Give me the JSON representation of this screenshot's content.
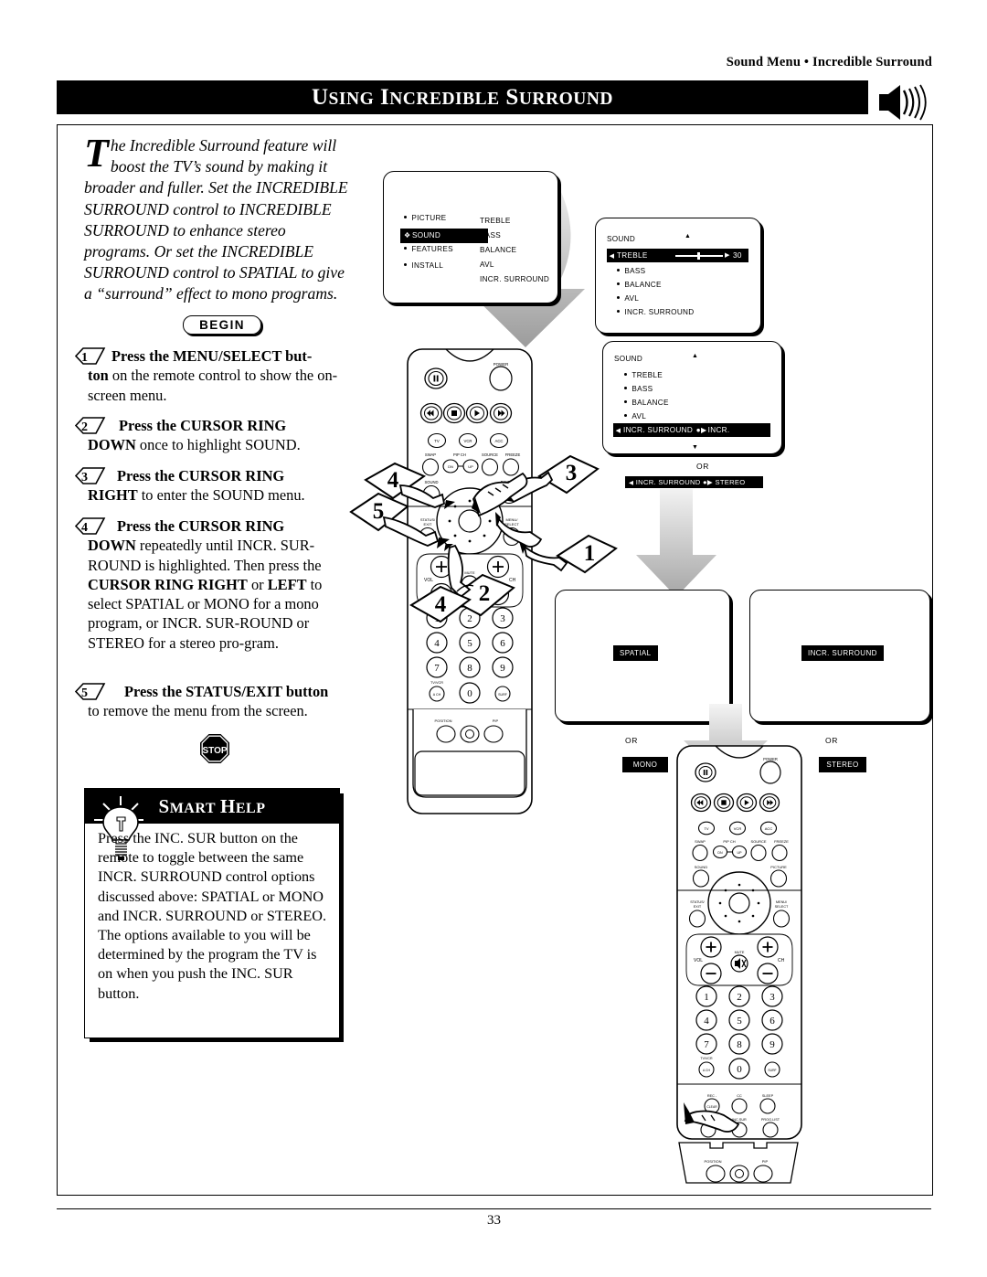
{
  "header": {
    "kicker": "Sound Menu • Incredible Surround",
    "title_word1_cap": "U",
    "title_word1_rest": "SING",
    "title_word2_cap": "I",
    "title_word2_rest": "NCREDIBLE",
    "title_word3_cap": "S",
    "title_word3_rest": "URROUND",
    "speaker_icon": "speaker-sound-icon"
  },
  "intro": {
    "dropcap": "T",
    "text": "he Incredible Surround feature will boost the TV’s sound by making it broader and fuller. Set the INCREDIBLE SURROUND control to INCREDIBLE SURROUND to enhance stereo programs. Or set the INCREDIBLE SURROUND control to SPATIAL to give a “surround” effect to mono programs."
  },
  "begin_label": "BEGIN",
  "steps": [
    {
      "n": "1",
      "lead": "Press the MENU/SELECT but-",
      "lead2": "ton",
      "rest": " on the remote control to show the on-screen menu."
    },
    {
      "n": "2",
      "lead": "Press the CURSOR RING",
      "lead2": "DOWN",
      "rest": " once to highlight SOUND."
    },
    {
      "n": "3",
      "lead": "Press the CURSOR RING",
      "lead2": "RIGHT",
      "rest": " to enter the SOUND menu."
    },
    {
      "n": "4",
      "lead": "Press the CURSOR RING",
      "lead2": "DOWN",
      "rest": " repeatedly until INCR. SUR-ROUND is highlighted. Then press the ",
      "bold2": "CURSOR RING RIGHT",
      "rest2": " or ",
      "bold3": "LEFT",
      "rest3": " to select SPATIAL or MONO for a mono program, or INCR. SUR-ROUND or STEREO for a stereo pro-gram."
    },
    {
      "n": "5",
      "lead": "Press the STATUS/EXIT button",
      "lead2": "",
      "rest": "to remove the menu from the screen."
    }
  ],
  "stop_label": "STOP",
  "smart_help": {
    "title_cap1": "S",
    "title_rest1": "MART",
    "title_cap2": "H",
    "title_rest2": "ELP",
    "bulb_icon": "lightbulb-icon",
    "body": "Press the INC. SUR button on the remote to toggle between the same INCR. SURROUND control options discussed above: SPATIAL or MONO and INCR. SURROUND or STEREO. The options available to you will be determined by the program the TV is on when you push the INC. SUR button."
  },
  "menu1": {
    "left_items": [
      {
        "label": "PICTURE",
        "highlighted": false
      },
      {
        "label": "SOUND",
        "highlighted": true
      },
      {
        "label": "FEATURES",
        "highlighted": false
      },
      {
        "label": "INSTALL",
        "highlighted": false
      }
    ],
    "right_items": [
      "TREBLE",
      "BASS",
      "BALANCE",
      "AVL",
      "INCR. SURROUND"
    ]
  },
  "menu2": {
    "title": "SOUND",
    "items": [
      {
        "label": "TREBLE",
        "highlighted": true,
        "value": "30"
      },
      {
        "label": "BASS",
        "highlighted": false
      },
      {
        "label": "BALANCE",
        "highlighted": false
      },
      {
        "label": "AVL",
        "highlighted": false
      },
      {
        "label": "INCR. SURROUND",
        "highlighted": false
      }
    ],
    "up_arrow": "▲",
    "down_arrow": "▼"
  },
  "menu3": {
    "title": "SOUND",
    "items": [
      {
        "label": "TREBLE",
        "highlighted": false
      },
      {
        "label": "BASS",
        "highlighted": false
      },
      {
        "label": "BALANCE",
        "highlighted": false
      },
      {
        "label": "AVL",
        "highlighted": false
      },
      {
        "label": "INCR. SURROUND",
        "highlighted": true,
        "value": "INCR. SURROUND"
      }
    ],
    "up_arrow": "▲",
    "down_arrow": "▼"
  },
  "or_bar": {
    "or_label": "OR",
    "item_label": "INCR. SURROUND",
    "item_value": "STEREO"
  },
  "screens": {
    "left_osd": "SPATIAL",
    "right_osd": "INCR. SURROUND",
    "left_or": "OR",
    "left_alt": "MONO",
    "right_or": "OR",
    "right_alt": "STEREO"
  },
  "remote": {
    "power": "POWER",
    "device_buttons": [
      "TV",
      "VCR",
      "ACC"
    ],
    "row_labels": [
      "SWAP",
      "PIP CH",
      "SOURCE",
      "FREEZE"
    ],
    "pip_dn": "DN",
    "pip_up": "UP",
    "sound": "SOUND",
    "picture": "PICTURE",
    "status_exit_1": "STATUS/",
    "status_exit_2": "EXIT",
    "menu_select_1": "MENU/",
    "menu_select_2": "SELECT",
    "vol": "VOL",
    "ch": "CH",
    "mute": "MUTE",
    "keys": [
      "1",
      "2",
      "3",
      "4",
      "5",
      "6",
      "7",
      "8",
      "9"
    ],
    "zero": "0",
    "tv_vcr_1": "TV/VCR",
    "tv_vcr_2": "A CH",
    "surf": "SURF",
    "rec_label": "REC -",
    "clear": "CLEAR",
    "cc": "CC",
    "sleep": "SLEEP",
    "inc_sur": "INC.SUR",
    "prog_list": "PROG.LIST",
    "position": "POSITION",
    "pip": "PIP"
  },
  "callouts": [
    "1",
    "2",
    "3",
    "4",
    "5"
  ],
  "page_number": "33"
}
